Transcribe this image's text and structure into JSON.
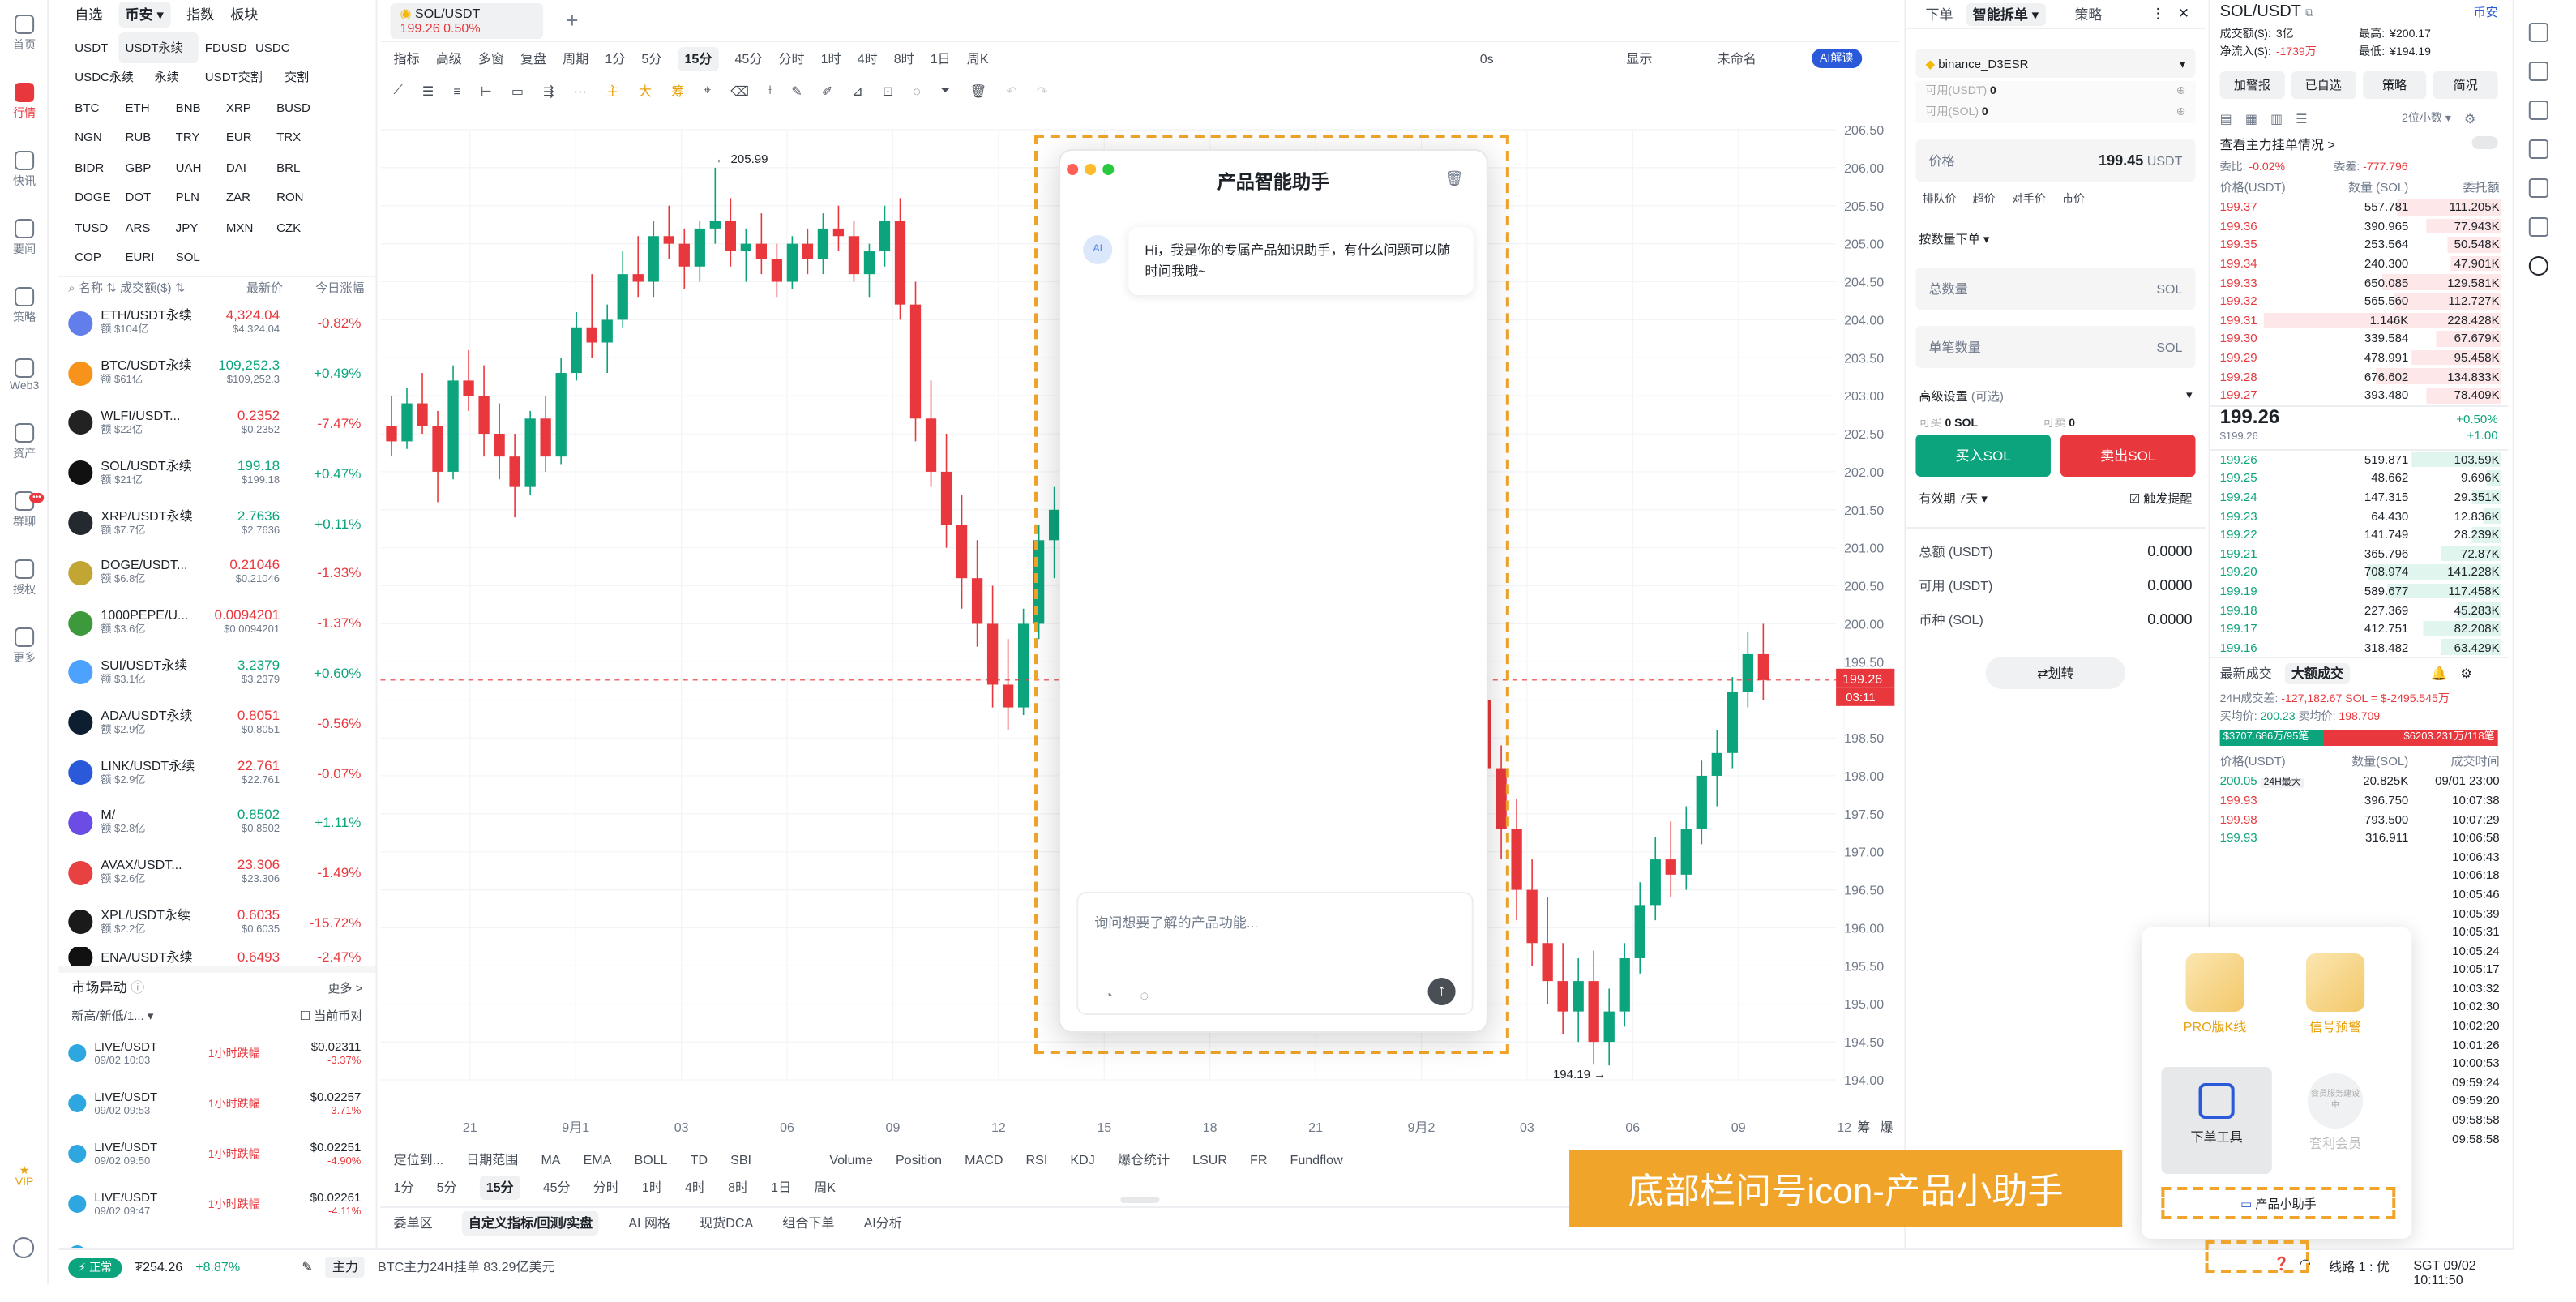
{
  "nav": {
    "items": [
      "首页",
      "行情",
      "快讯",
      "要闻",
      "策略",
      "Web3",
      "资产",
      "群聊",
      "授权",
      "更多"
    ],
    "vip": "VIP",
    "badge": "•••"
  },
  "market": {
    "tabs": [
      "自选",
      "币安",
      "指数",
      "板块"
    ],
    "chips": [
      "USDT",
      "USDT永续",
      "FDUSD",
      "USDC",
      "USDC永续",
      "永续",
      "USDT交割",
      "交割",
      "BTC",
      "ETH",
      "BNB",
      "XRP",
      "BUSD",
      "NGN",
      "RUB",
      "TRY",
      "EUR",
      "TRX",
      "BIDR",
      "GBP",
      "UAH",
      "DAI",
      "BRL",
      "DOGE",
      "DOT",
      "PLN",
      "ZAR",
      "RON",
      "TUSD",
      "ARS",
      "JPY",
      "MXN",
      "CZK",
      "COP",
      "EURI",
      "SOL"
    ],
    "head": [
      "名称",
      "成交额($)",
      "最新价",
      "今日涨幅"
    ],
    "coins": [
      {
        "name": "ETH/USDT永续",
        "vol": "额 $104亿",
        "price": "4,324.04",
        "sub": "$4,324.04",
        "chg": "-0.82%",
        "up": false,
        "color": "#627eea"
      },
      {
        "name": "BTC/USDT永续",
        "vol": "额 $61亿",
        "price": "109,252.3",
        "sub": "$109,252.3",
        "chg": "+0.49%",
        "up": true,
        "color": "#f7931a"
      },
      {
        "name": "WLFI/USDT...",
        "vol": "额 $22亿",
        "price": "0.2352",
        "sub": "$0.2352",
        "chg": "-7.47%",
        "up": false,
        "color": "#222"
      },
      {
        "name": "SOL/USDT永续",
        "vol": "额 $21亿",
        "price": "199.18",
        "sub": "$199.18",
        "chg": "+0.47%",
        "up": true,
        "color": "#111"
      },
      {
        "name": "XRP/USDT永续",
        "vol": "额 $7.7亿",
        "price": "2.7636",
        "sub": "$2.7636",
        "chg": "+0.11%",
        "up": true,
        "color": "#23292f"
      },
      {
        "name": "DOGE/USDT...",
        "vol": "额 $6.8亿",
        "price": "0.21046",
        "sub": "$0.21046",
        "chg": "-1.33%",
        "up": false,
        "color": "#c2a633"
      },
      {
        "name": "1000PEPE/U...",
        "vol": "额 $3.6亿",
        "price": "0.0094201",
        "sub": "$0.0094201",
        "chg": "-1.37%",
        "up": false,
        "color": "#3c9a3c"
      },
      {
        "name": "SUI/USDT永续",
        "vol": "额 $3.1亿",
        "price": "3.2379",
        "sub": "$3.2379",
        "chg": "+0.60%",
        "up": true,
        "color": "#4da2ff"
      },
      {
        "name": "ADA/USDT永续",
        "vol": "额 $2.9亿",
        "price": "0.8051",
        "sub": "$0.8051",
        "chg": "-0.56%",
        "up": false,
        "color": "#0d1e30"
      },
      {
        "name": "LINK/USDT永续",
        "vol": "额 $2.9亿",
        "price": "22.761",
        "sub": "$22.761",
        "chg": "-0.07%",
        "up": false,
        "color": "#2a5ada"
      },
      {
        "name": "M/",
        "vol": "额 $2.8亿",
        "price": "0.8502",
        "sub": "$0.8502",
        "chg": "+1.11%",
        "up": true,
        "color": "#6b4de6"
      },
      {
        "name": "AVAX/USDT...",
        "vol": "额 $2.6亿",
        "price": "23.306",
        "sub": "$23.306",
        "chg": "-1.49%",
        "up": false,
        "color": "#e84142"
      },
      {
        "name": "XPL/USDT永续",
        "vol": "额 $2.2亿",
        "price": "0.6035",
        "sub": "$0.6035",
        "chg": "-15.72%",
        "up": false,
        "color": "#1a1a1a"
      }
    ],
    "partial": {
      "name": "ENA/USDT永续",
      "price": "0.6493",
      "chg": "-2.47%"
    },
    "alerts_title": "市场异动",
    "alerts_more": "更多 >",
    "alerts_filter": "新高/新低/1...",
    "alerts_current": "当前币对",
    "alerts": [
      {
        "pair": "LIVE/USDT",
        "time": "09/02 10:03",
        "label": "1小时跌幅",
        "price": "$0.02311",
        "chg": "-3.37%"
      },
      {
        "pair": "LIVE/USDT",
        "time": "09/02 09:53",
        "label": "1小时跌幅",
        "price": "$0.02257",
        "chg": "-3.71%"
      },
      {
        "pair": "LIVE/USDT",
        "time": "09/02 09:50",
        "label": "1小时跌幅",
        "price": "$0.02251",
        "chg": "-4.90%"
      },
      {
        "pair": "LIVE/USDT",
        "time": "09/02 09:47",
        "label": "1小时跌幅",
        "price": "$0.02261",
        "chg": "-4.11%"
      },
      {
        "pair": "LIVE/USDT",
        "time": "",
        "label": "1小时跌幅",
        "price": "$0.02261",
        "chg": ""
      }
    ]
  },
  "chart": {
    "tab": {
      "pair": "SOL/USDT",
      "price": "199.26",
      "chg": "0.50%"
    },
    "toolbar1": [
      "指标",
      "高级",
      "多窗",
      "复盘",
      "周期",
      "1分",
      "5分",
      "15分",
      "45分",
      "分时",
      "1时",
      "4时",
      "8时",
      "1日",
      "周K"
    ],
    "toolbar1_right": [
      "0s",
      "显示",
      "未命名",
      "AI解读"
    ],
    "toolbar2_colored": [
      "主",
      "大",
      "筹"
    ],
    "hi_label": "← 205.99",
    "lo_label": "194.19 →",
    "last_price": "199.26",
    "countdown": "03:11",
    "yticks": [
      "206.50",
      "206.00",
      "205.50",
      "205.00",
      "204.50",
      "204.00",
      "203.50",
      "203.00",
      "202.50",
      "202.00",
      "201.50",
      "201.00",
      "200.50",
      "200.00",
      "199.50",
      "199.00",
      "198.50",
      "198.00",
      "197.50",
      "197.00",
      "196.50",
      "196.00",
      "195.50",
      "195.00",
      "194.50",
      "194.00"
    ],
    "xticks": [
      "21",
      "9月1",
      "03",
      "06",
      "09",
      "12",
      "15",
      "18",
      "21",
      "9月2",
      "03",
      "06",
      "09",
      "12"
    ],
    "x_right": [
      "筹",
      "爆"
    ],
    "bottom_tools": [
      "定位到...",
      "日期范围",
      "MA",
      "EMA",
      "BOLL",
      "TD",
      "SBI",
      "Volume",
      "Position",
      "MACD",
      "RSI",
      "KDJ",
      "爆仓统计",
      "LSUR",
      "FR",
      "Fundflow"
    ],
    "periods": [
      "1分",
      "5分",
      "15分",
      "45分",
      "分时",
      "1时",
      "4时",
      "8时",
      "1日",
      "周K"
    ],
    "bottom_tabs": [
      "委单区",
      "自定义指标/回测/实盘",
      "AI 网格",
      "现货DCA",
      "组合下单",
      "AI分析"
    ]
  },
  "dialog": {
    "title": "产品智能助手",
    "greeting": "Hi，我是你的专属产品知识助手，有什么问题可以随时问我哦~",
    "placeholder": "询问想要了解的产品功能...",
    "avatar": "AI"
  },
  "order": {
    "tabs": [
      "下单",
      "智能拆单",
      "策略"
    ],
    "account": "binance_D3ESR",
    "avail_usdt": "可用(USDT)",
    "avail_usdt_v": "0",
    "avail_sol": "可用(SOL)",
    "avail_sol_v": "0",
    "price_label": "价格",
    "price_value": "199.45",
    "price_unit": "USDT",
    "price_opts": [
      "排队价",
      "超价",
      "对手价",
      "市价"
    ],
    "mode": "按数量下单",
    "total_label": "总数量",
    "single_label": "单笔数量",
    "unit": "SOL",
    "adv": "高级设置",
    "adv2": "(可选)",
    "can_buy": "可买",
    "can_buy_v": "0 SOL",
    "can_sell": "可卖",
    "can_sell_v": "0",
    "buy": "买入SOL",
    "sell": "卖出SOL",
    "valid": "有效期",
    "valid_v": "7天",
    "trigger": "触发提醒",
    "totals": [
      {
        "l": "总额 (USDT)",
        "v": "0.0000"
      },
      {
        "l": "可用 (USDT)",
        "v": "0.0000"
      },
      {
        "l": "币种 (SOL)",
        "v": "0.0000"
      }
    ],
    "transfer": "划转",
    "popup": [
      "PRO版K线",
      "信号预警",
      "下单工具",
      "套利会员"
    ],
    "popup_badge": "会员服务建设中",
    "helper": "产品小助手"
  },
  "book": {
    "pair": "SOL/USDT",
    "spot": "币安",
    "stats": [
      {
        "l": "成交额($):",
        "v": "3亿"
      },
      {
        "l": "最高:",
        "v": "¥200.17"
      },
      {
        "l": "净流入($):",
        "v": "-1739万"
      },
      {
        "l": "最低:",
        "v": "¥194.19"
      }
    ],
    "btns": [
      "加警报",
      "已自选",
      "策略",
      "简况"
    ],
    "depth": "2位小数",
    "watch": "查看主力挂单情况 >",
    "ratio": {
      "l1": "委比:",
      "v1": "-0.02%",
      "l2": "委差:",
      "v2": "-777.796"
    },
    "head": [
      "价格(USDT)",
      "数量 (SOL)",
      "委托额"
    ],
    "asks": [
      {
        "p": "199.37",
        "q": "557.781",
        "t": "111.205K",
        "w": 0.35
      },
      {
        "p": "199.36",
        "q": "390.965",
        "t": "77.943K",
        "w": 0.25
      },
      {
        "p": "199.35",
        "q": "253.564",
        "t": "50.548K",
        "w": 0.18
      },
      {
        "p": "199.34",
        "q": "240.300",
        "t": "47.901K",
        "w": 0.17
      },
      {
        "p": "199.33",
        "q": "650.085",
        "t": "129.581K",
        "w": 0.4
      },
      {
        "p": "199.32",
        "q": "565.560",
        "t": "112.727K",
        "w": 0.36
      },
      {
        "p": "199.31",
        "q": "1.146K",
        "t": "228.428K",
        "w": 0.8
      },
      {
        "p": "199.30",
        "q": "339.584",
        "t": "67.679K",
        "w": 0.22
      },
      {
        "p": "199.29",
        "q": "478.991",
        "t": "95.458K",
        "w": 0.3
      },
      {
        "p": "199.28",
        "q": "676.602",
        "t": "134.833K",
        "w": 0.42
      },
      {
        "p": "199.27",
        "q": "393.480",
        "t": "78.409K",
        "w": 0.25
      }
    ],
    "mid": "199.26",
    "mid_sub": "$199.26",
    "mid_chg": "+0.50%",
    "mid_abs": "+1.00",
    "bids": [
      {
        "p": "199.26",
        "q": "519.871",
        "t": "103.59K",
        "w": 0.3
      },
      {
        "p": "199.25",
        "q": "48.662",
        "t": "9.696K",
        "w": 0.05
      },
      {
        "p": "199.24",
        "q": "147.315",
        "t": "29.351K",
        "w": 0.1
      },
      {
        "p": "199.23",
        "q": "64.430",
        "t": "12.836K",
        "w": 0.06
      },
      {
        "p": "199.22",
        "q": "141.749",
        "t": "28.239K",
        "w": 0.1
      },
      {
        "p": "199.21",
        "q": "365.796",
        "t": "72.87K",
        "w": 0.2
      },
      {
        "p": "199.20",
        "q": "708.974",
        "t": "141.228K",
        "w": 0.45
      },
      {
        "p": "199.19",
        "q": "589.677",
        "t": "117.458K",
        "w": 0.38
      },
      {
        "p": "199.18",
        "q": "227.369",
        "t": "45.283K",
        "w": 0.15
      },
      {
        "p": "199.17",
        "q": "412.751",
        "t": "82.208K",
        "w": 0.26
      },
      {
        "p": "199.16",
        "q": "318.482",
        "t": "63.429K",
        "w": 0.2
      }
    ],
    "trade_tabs": [
      "最新成交",
      "大额成交"
    ],
    "vol24": "24H成交差:",
    "vol24_v": "-127,182.67 SOL = $-2495.545万",
    "buy_avg": "买均价:",
    "buy_avg_v": "200.23",
    "sell_avg": "卖均价:",
    "sell_avg_v": "198.709",
    "bar_buy": "$3707.686万/95笔",
    "bar_sell": "$6203.231万/118笔",
    "trade_head": [
      "价格(USDT)",
      "数量(SOL)",
      "成交时间"
    ],
    "trades": [
      {
        "p": "200.05",
        "tag": "24H最大",
        "q": "20.825K",
        "t": "09/01 23:00"
      },
      {
        "p": "199.93",
        "tag": "",
        "q": "396.750",
        "t": "10:07:38"
      },
      {
        "p": "199.98",
        "tag": "",
        "q": "793.500",
        "t": "10:07:29"
      },
      {
        "p": "199.93",
        "tag": "",
        "q": "316.911",
        "t": "10:06:58"
      },
      {
        "p": "",
        "tag": "",
        "q": "",
        "t": "10:06:43"
      },
      {
        "p": "",
        "tag": "",
        "q": "",
        "t": "10:06:18"
      },
      {
        "p": "",
        "tag": "",
        "q": "",
        "t": "10:05:46"
      },
      {
        "p": "",
        "tag": "",
        "q": "",
        "t": "10:05:39"
      },
      {
        "p": "",
        "tag": "",
        "q": "",
        "t": "10:05:31"
      },
      {
        "p": "",
        "tag": "",
        "q": "",
        "t": "10:05:24"
      },
      {
        "p": "",
        "tag": "",
        "q": "",
        "t": "10:05:17"
      },
      {
        "p": "",
        "tag": "",
        "q": "",
        "t": "10:03:32"
      },
      {
        "p": "",
        "tag": "",
        "q": "",
        "t": "10:02:30"
      },
      {
        "p": "",
        "tag": "",
        "q": "",
        "t": "10:02:20"
      },
      {
        "p": "",
        "tag": "",
        "q": "",
        "t": "10:01:26"
      },
      {
        "p": "",
        "tag": "",
        "q": "",
        "t": "10:00:53"
      },
      {
        "p": "",
        "tag": "",
        "q": "",
        "t": "09:59:24"
      },
      {
        "p": "",
        "tag": "",
        "q": "",
        "t": "09:59:20"
      },
      {
        "p": "",
        "tag": "",
        "q": "",
        "t": "09:58:58"
      },
      {
        "p": "",
        "tag": "",
        "q": "",
        "t": "09:58:58"
      }
    ]
  },
  "status": {
    "live": "正常",
    "price": "₮254.26",
    "chg": "+8.87%",
    "tag": "主力",
    "ticker": "BTC主力24H挂单 83.29亿美元",
    "line": "线路 1 : 优",
    "time": "SGT 09/02 10:11:50"
  },
  "banner": "底部栏问号icon-产品小助手",
  "candles": [
    [
      202.6,
      203.0,
      202.2,
      202.4
    ],
    [
      202.4,
      203.1,
      202.3,
      202.9
    ],
    [
      202.9,
      203.3,
      202.5,
      202.6
    ],
    [
      202.6,
      202.8,
      201.6,
      202.0
    ],
    [
      202.0,
      203.4,
      201.9,
      203.2
    ],
    [
      203.2,
      203.6,
      202.8,
      203.0
    ],
    [
      203.0,
      203.4,
      202.2,
      202.5
    ],
    [
      202.5,
      202.9,
      201.9,
      202.2
    ],
    [
      202.2,
      202.5,
      201.4,
      201.8
    ],
    [
      201.8,
      202.8,
      201.7,
      202.7
    ],
    [
      202.7,
      203.0,
      202.0,
      202.2
    ],
    [
      202.2,
      203.5,
      202.1,
      203.3
    ],
    [
      203.3,
      204.1,
      203.2,
      203.9
    ],
    [
      203.9,
      204.6,
      203.5,
      203.7
    ],
    [
      203.7,
      204.2,
      203.3,
      204.0
    ],
    [
      204.0,
      204.9,
      203.9,
      204.6
    ],
    [
      204.6,
      205.1,
      204.3,
      204.5
    ],
    [
      204.5,
      205.3,
      204.3,
      205.1
    ],
    [
      205.1,
      205.5,
      204.8,
      205.0
    ],
    [
      205.0,
      205.2,
      204.4,
      204.7
    ],
    [
      204.7,
      205.3,
      204.5,
      205.2
    ],
    [
      205.2,
      206.0,
      205.0,
      205.3
    ],
    [
      205.3,
      205.6,
      204.7,
      204.9
    ],
    [
      204.9,
      205.2,
      204.5,
      205.0
    ],
    [
      205.0,
      205.4,
      204.6,
      204.8
    ],
    [
      204.8,
      205.0,
      204.3,
      204.5
    ],
    [
      204.5,
      205.1,
      204.4,
      205.0
    ],
    [
      205.0,
      205.2,
      204.6,
      204.8
    ],
    [
      204.8,
      205.4,
      204.6,
      205.2
    ],
    [
      205.2,
      205.5,
      204.9,
      205.1
    ],
    [
      205.1,
      205.3,
      204.5,
      204.6
    ],
    [
      204.6,
      205.0,
      204.3,
      204.9
    ],
    [
      204.9,
      205.5,
      204.7,
      205.3
    ],
    [
      205.3,
      205.6,
      204.0,
      204.2
    ],
    [
      204.2,
      204.5,
      202.4,
      202.7
    ],
    [
      202.7,
      203.2,
      201.8,
      202.0
    ],
    [
      202.0,
      202.5,
      201.0,
      201.3
    ],
    [
      201.3,
      201.7,
      200.2,
      200.6
    ],
    [
      200.6,
      201.1,
      199.7,
      200.0
    ],
    [
      200.0,
      200.5,
      198.9,
      199.2
    ],
    [
      199.2,
      199.8,
      198.6,
      198.9
    ],
    [
      198.9,
      200.2,
      198.8,
      200.0
    ],
    [
      200.0,
      201.3,
      199.8,
      201.1
    ],
    [
      201.1,
      201.8,
      200.6,
      201.5
    ],
    [
      201.5,
      202.4,
      201.2,
      202.2
    ],
    [
      202.2,
      202.6,
      201.8,
      202.0
    ],
    [
      202.0,
      202.3,
      200.7,
      201.0
    ],
    [
      201.0,
      201.2,
      199.5,
      199.8
    ],
    [
      199.8,
      200.1,
      198.2,
      198.5
    ],
    [
      198.5,
      198.8,
      196.5,
      196.9
    ],
    [
      196.9,
      197.5,
      196.3,
      197.2
    ],
    [
      197.2,
      198.4,
      197.0,
      198.1
    ],
    [
      198.1,
      198.6,
      197.4,
      197.8
    ],
    [
      197.8,
      198.3,
      197.2,
      198.0
    ],
    [
      198.0,
      198.5,
      197.5,
      197.7
    ],
    [
      197.7,
      198.1,
      196.8,
      197.2
    ],
    [
      197.2,
      197.6,
      196.4,
      196.8
    ],
    [
      196.8,
      197.9,
      196.6,
      197.6
    ],
    [
      197.6,
      198.4,
      197.3,
      198.2
    ],
    [
      198.2,
      198.5,
      197.8,
      198.0
    ],
    [
      198.0,
      198.9,
      197.7,
      198.6
    ],
    [
      198.6,
      199.2,
      198.3,
      198.9
    ],
    [
      198.9,
      199.3,
      198.4,
      198.7
    ],
    [
      198.7,
      199.0,
      198.1,
      198.4
    ],
    [
      198.4,
      198.6,
      197.7,
      197.9
    ],
    [
      197.9,
      198.2,
      197.3,
      197.5
    ],
    [
      197.5,
      198.5,
      197.4,
      198.3
    ],
    [
      198.3,
      199.6,
      198.2,
      199.4
    ],
    [
      199.4,
      200.1,
      199.0,
      199.7
    ],
    [
      199.7,
      200.2,
      199.2,
      199.5
    ],
    [
      199.5,
      199.8,
      198.7,
      199.0
    ],
    [
      199.0,
      199.4,
      197.8,
      198.1
    ],
    [
      198.1,
      198.4,
      196.9,
      197.3
    ],
    [
      197.3,
      197.7,
      196.1,
      196.5
    ],
    [
      196.5,
      196.9,
      195.5,
      195.8
    ],
    [
      195.8,
      196.4,
      195.0,
      195.3
    ],
    [
      195.3,
      195.8,
      194.6,
      194.9
    ],
    [
      194.9,
      195.6,
      194.5,
      195.3
    ],
    [
      195.3,
      195.7,
      194.2,
      194.5
    ],
    [
      194.5,
      195.2,
      194.19,
      194.9
    ],
    [
      194.9,
      195.8,
      194.7,
      195.6
    ],
    [
      195.6,
      196.6,
      195.4,
      196.3
    ],
    [
      196.3,
      197.2,
      196.1,
      196.9
    ],
    [
      196.9,
      197.4,
      196.4,
      196.7
    ],
    [
      196.7,
      197.6,
      196.5,
      197.3
    ],
    [
      197.3,
      198.2,
      197.1,
      198.0
    ],
    [
      198.0,
      198.6,
      197.6,
      198.3
    ],
    [
      198.3,
      199.3,
      198.1,
      199.1
    ],
    [
      199.1,
      199.9,
      198.9,
      199.6
    ],
    [
      199.6,
      200.0,
      199.0,
      199.26
    ]
  ]
}
